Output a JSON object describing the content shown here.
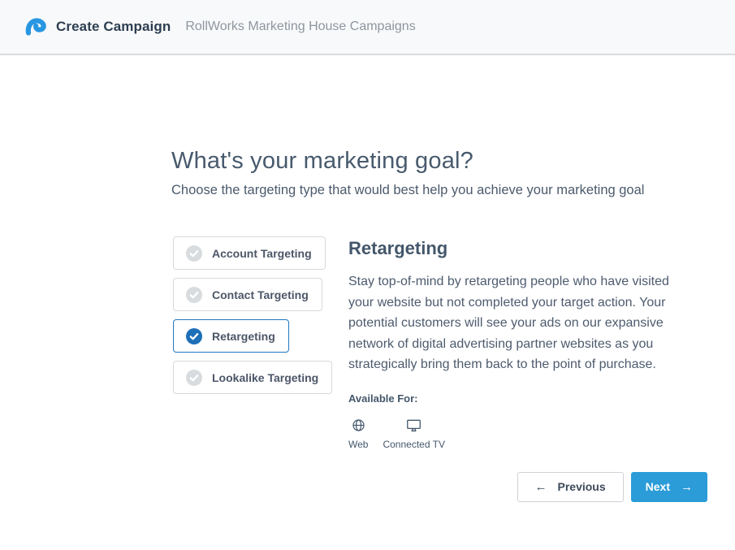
{
  "header": {
    "title": "Create Campaign",
    "subtitle": "RollWorks Marketing House Campaigns"
  },
  "main": {
    "heading": "What's your marketing goal?",
    "subheading": "Choose the targeting type that would best help you achieve your marketing goal",
    "options": [
      {
        "label": "Account Targeting",
        "selected": false
      },
      {
        "label": "Contact Targeting",
        "selected": false
      },
      {
        "label": "Retargeting",
        "selected": true
      },
      {
        "label": "Lookalike Targeting",
        "selected": false
      }
    ],
    "details": {
      "title": "Retargeting",
      "description": "Stay top-of-mind by retargeting people who have visited your website but not completed your target action. Your potential customers will see your ads on our expansive network of digital advertising partner websites as you strategically bring them back to the point of purchase.",
      "available_for_label": "Available For:",
      "platforms": [
        {
          "label": "Web",
          "icon": "globe-icon"
        },
        {
          "label": "Connected TV",
          "icon": "connected-tv-icon"
        }
      ]
    },
    "footer": {
      "previous_label": "Previous",
      "previous_arrow": "←",
      "next_label": "Next",
      "next_arrow": "→"
    }
  },
  "colors": {
    "accent_blue": "#2b9cd8",
    "selected_check_blue": "#1d6fb8",
    "unselected_check_gray": "#d9dcdf",
    "header_bg": "#f8f9fa",
    "text_dark_slate": "#44576b",
    "header_muted_gray": "#8e96a0",
    "logo_blue": "#2897e2"
  }
}
